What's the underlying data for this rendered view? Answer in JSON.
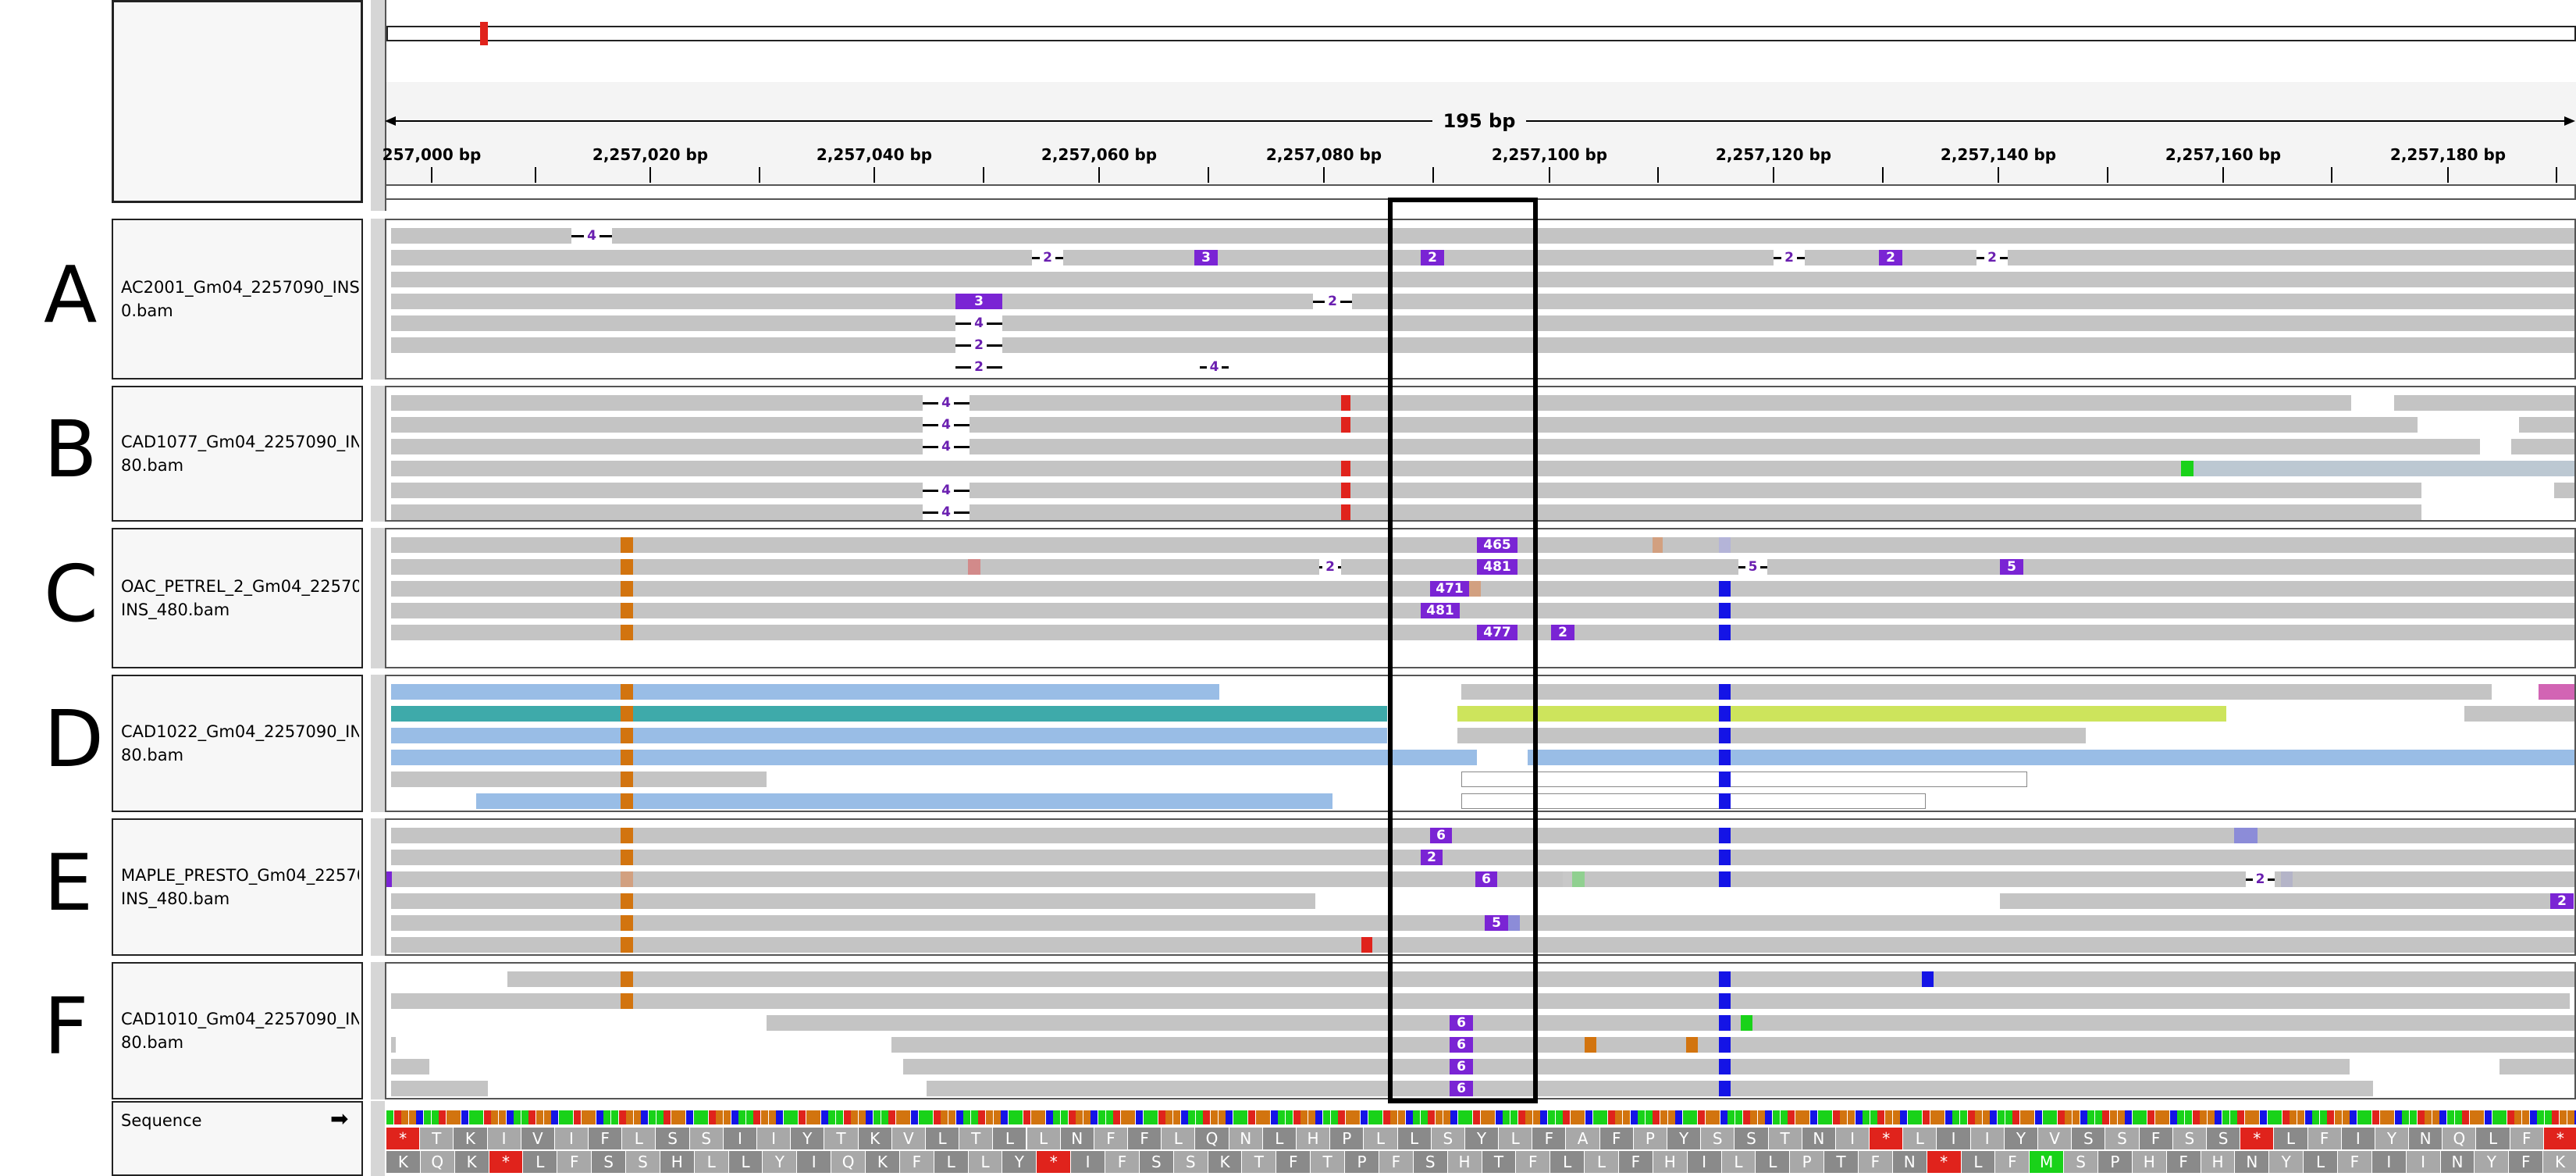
{
  "ruler": {
    "span_label": "195 bp",
    "ticks": [
      "257,000 bp",
      "2,257,020 bp",
      "2,257,040 bp",
      "2,257,060 bp",
      "2,257,080 bp",
      "2,257,100 bp",
      "2,257,120 bp",
      "2,257,140 bp",
      "2,257,160 bp",
      "2,257,180 bp"
    ]
  },
  "tracks": [
    {
      "letter": "A",
      "name_line1": "AC2001_Gm04_2257090_INS_4",
      "name_line2": "0.bam"
    },
    {
      "letter": "B",
      "name_line1": "CAD1077_Gm04_2257090_INS_4",
      "name_line2": "80.bam"
    },
    {
      "letter": "C",
      "name_line1": "OAC_PETREL_2_Gm04_2257090_",
      "name_line2": "INS_480.bam"
    },
    {
      "letter": "D",
      "name_line1": "CAD1022_Gm04_2257090_INS_4",
      "name_line2": "80.bam"
    },
    {
      "letter": "E",
      "name_line1": "MAPLE_PRESTO_Gm04_2257090_",
      "name_line2": "INS_480.bam"
    },
    {
      "letter": "F",
      "name_line1": "CAD1010_Gm04_2257090_INS_4",
      "name_line2": "80.bam"
    }
  ],
  "sequence": {
    "label": "Sequence",
    "arrow": "➡"
  },
  "frame1": [
    "*",
    "T",
    "K",
    "I",
    "V",
    "I",
    "F",
    "L",
    "S",
    "S",
    "I",
    "I",
    "Y",
    "T",
    "K",
    "V",
    "L",
    "T",
    "L",
    "L",
    "N",
    "F",
    "F",
    "L",
    "Q",
    "N",
    "L",
    "H",
    "P",
    "L",
    "L",
    "S",
    "Y",
    "L",
    "F",
    "A",
    "F",
    "P",
    "Y",
    "S",
    "S",
    "T",
    "N",
    "I",
    "*",
    "L",
    "I",
    "I",
    "Y",
    "V",
    "S",
    "S",
    "F",
    "S",
    "S",
    "*",
    "L",
    "F",
    "I",
    "Y",
    "N",
    "Q",
    "L",
    "F",
    "*"
  ],
  "frame2": [
    "K",
    "Q",
    "K",
    "*",
    "L",
    "F",
    "S",
    "S",
    "H",
    "L",
    "L",
    "Y",
    "I",
    "Q",
    "K",
    "F",
    "L",
    "L",
    "Y",
    "*",
    "I",
    "F",
    "S",
    "S",
    "K",
    "T",
    "F",
    "T",
    "P",
    "F",
    "S",
    "H",
    "T",
    "F",
    "L",
    "L",
    "F",
    "H",
    "I",
    "L",
    "L",
    "P",
    "T",
    "F",
    "N",
    "*",
    "L",
    "F",
    "M",
    "S",
    "P",
    "H",
    "F",
    "H",
    "N",
    "Y",
    "L",
    "F",
    "I",
    "I",
    "N",
    "Y",
    "F",
    "K"
  ],
  "indel_labels": {
    "A": [
      "4",
      "2",
      "3",
      "2",
      "2",
      "2",
      "2",
      "3",
      "4",
      "4",
      "4",
      "2",
      "2"
    ],
    "B": [
      "4",
      "4",
      "4",
      "4",
      "4"
    ],
    "C": [
      "465",
      "481",
      "2",
      "5",
      "471",
      "481",
      "477",
      "2"
    ],
    "E": [
      "6",
      "2",
      "6",
      "2",
      "5",
      "2"
    ],
    "F": [
      "6",
      "6",
      "6",
      "6"
    ]
  },
  "colors": {
    "read": "#c4c4c4",
    "insertion": "#7a24d4",
    "mismatch_T": "#e0231c",
    "mismatch_C": "#1414e6",
    "mismatch_G": "#d2740f",
    "mismatch_A": "#19d219",
    "pair_blue": "#99bde6",
    "pair_teal": "#3eaaaa",
    "pair_lime": "#cde45c",
    "pair_magenta": "#d264b4"
  }
}
